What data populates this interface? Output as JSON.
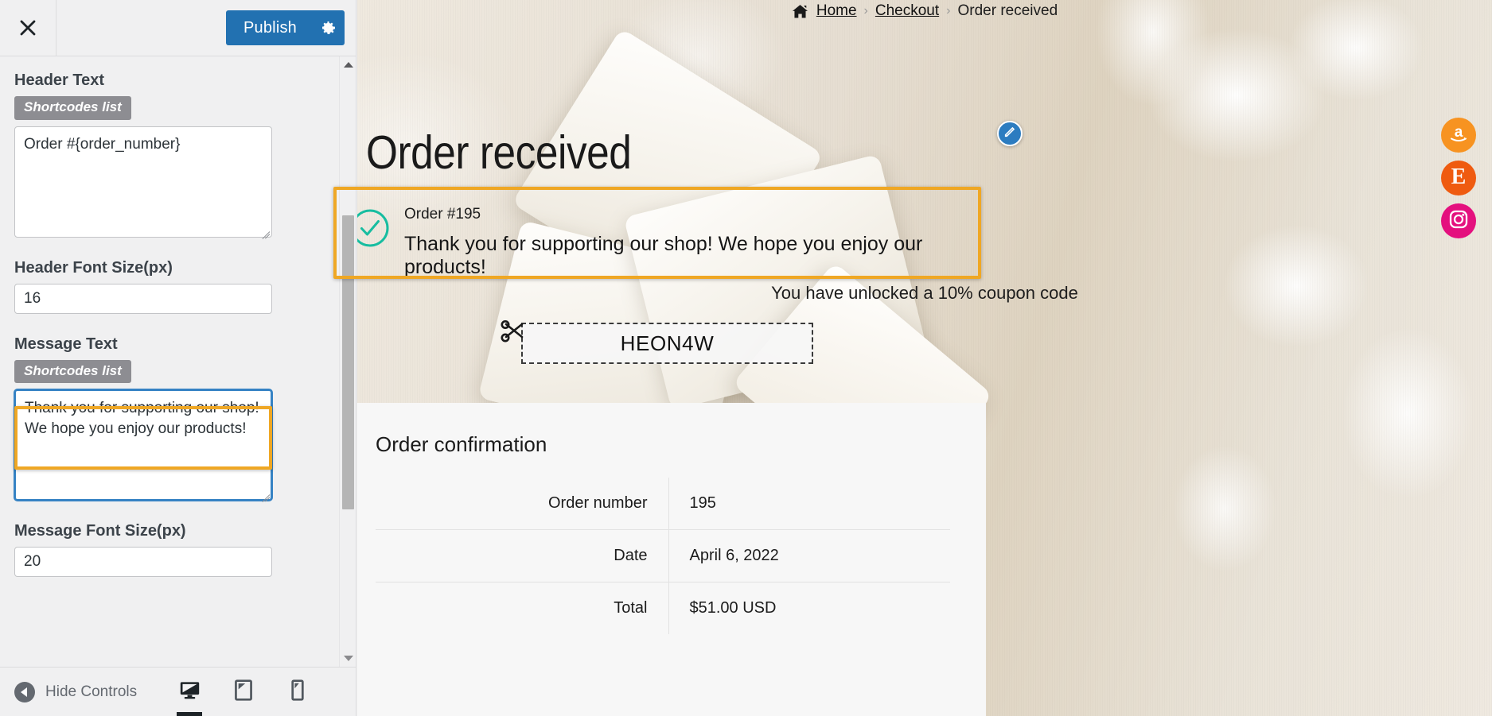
{
  "customizer": {
    "close_icon": "close-x-icon",
    "publish_label": "Publish",
    "gear_icon": "gear-icon",
    "accent_blue": "#2271b1",
    "highlight_orange": "#efa724",
    "focus_blue": "#3582c4",
    "fields": [
      {
        "label": "Header Text",
        "shortcodes_label": "Shortcodes list",
        "type": "textarea",
        "value": "Order #{order_number}"
      },
      {
        "label": "Header Font Size(px)",
        "type": "text",
        "value": "16"
      },
      {
        "label": "Message Text",
        "shortcodes_label": "Shortcodes list",
        "type": "textarea",
        "value": "Thank you for supporting our shop! We hope you enjoy our products!"
      },
      {
        "label": "Message Font Size(px)",
        "type": "text",
        "value": "20"
      }
    ],
    "footer": {
      "hide_controls_label": "Hide Controls",
      "back_icon": "chevron-left-circle-icon",
      "devices": [
        {
          "name": "desktop",
          "icon": "desktop-icon",
          "active": true
        },
        {
          "name": "tablet",
          "icon": "tablet-icon",
          "active": false
        },
        {
          "name": "mobile",
          "icon": "mobile-icon",
          "active": false
        }
      ]
    },
    "scrollbar": {
      "up_icon": "scroll-up-arrow-icon",
      "down_icon": "scroll-down-arrow-icon"
    }
  },
  "preview": {
    "breadcrumb": {
      "home_icon": "home-icon",
      "items": [
        "Home",
        "Checkout"
      ],
      "separator": "›",
      "current": "Order received"
    },
    "page_title": "Order received",
    "thankyou": {
      "check_icon": "check-circle-icon",
      "order_number_line": "Order #195",
      "message": "Thank you for supporting our shop! We hope you enjoy our products!"
    },
    "coupon": {
      "note": "You have unlocked a 10% coupon code",
      "scissors_icon": "scissors-icon",
      "code": "HEON4W"
    },
    "confirmation": {
      "title": "Order confirmation",
      "rows": [
        {
          "label": "Order number",
          "value": "195"
        },
        {
          "label": "Date",
          "value": "April 6, 2022"
        },
        {
          "label": "Total",
          "value": "$51.00 USD"
        }
      ]
    },
    "edit_button": {
      "icon": "pencil-edit-icon",
      "color": "#2c7cc0"
    },
    "social": [
      {
        "name": "amazon",
        "icon": "amazon-icon",
        "glyph": "a",
        "color": "#f79321"
      },
      {
        "name": "etsy",
        "icon": "etsy-icon",
        "glyph": "E",
        "color": "#ef5b10"
      },
      {
        "name": "instagram",
        "icon": "instagram-icon",
        "glyph": "",
        "color": "#e4107e"
      }
    ]
  }
}
